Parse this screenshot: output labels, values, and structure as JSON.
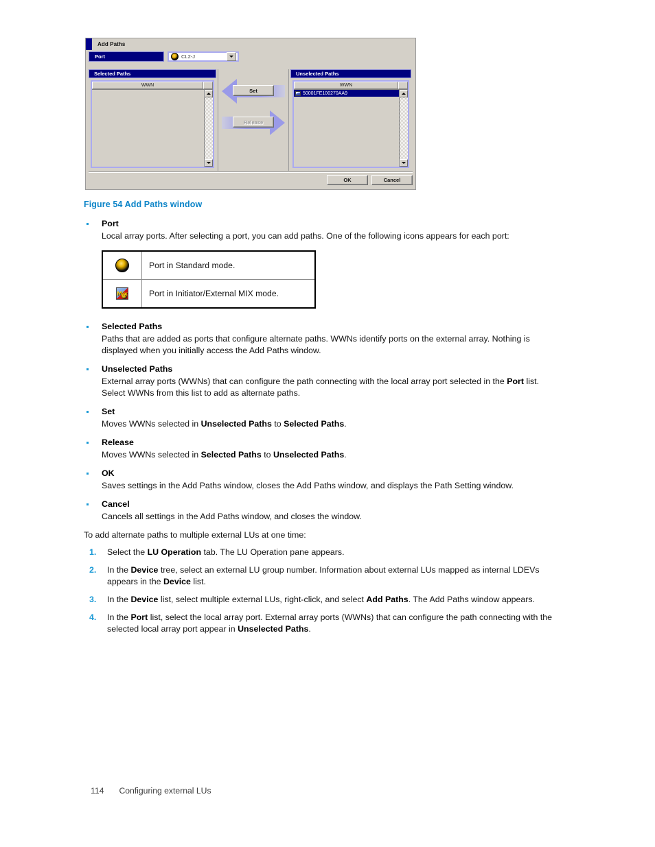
{
  "figure": {
    "dialog": {
      "title": "Add Paths",
      "port_label": "Port",
      "port_value": "CL2-J",
      "port_icon": "port-standard-icon",
      "selected_paths": {
        "header": "Selected Paths",
        "column": "WWN",
        "rows": []
      },
      "unselected_paths": {
        "header": "Unselected Paths",
        "column": "WWN",
        "rows": [
          "50001FE100270AA9"
        ]
      },
      "set_button": "Set",
      "release_button": "Release",
      "ok_button": "OK",
      "cancel_button": "Cancel"
    }
  },
  "caption": "Figure 54 Add Paths window",
  "bullets": [
    {
      "term": "Port",
      "body": "Local array ports. After selecting a port, you can add paths. One of the following icons appears for each port:"
    },
    {
      "term": "Selected Paths",
      "body": "Paths that are added as ports that configure alternate paths. WWNs identify ports on the external array. Nothing is displayed when you initially access the Add Paths window."
    },
    {
      "term": "Unselected Paths"
    },
    {
      "term": "Set"
    },
    {
      "term": "Release"
    },
    {
      "term": "OK",
      "body": "Saves settings in the Add Paths window, closes the Add Paths window, and displays the Path Setting window."
    },
    {
      "term": "Cancel",
      "body": "Cancels all settings in the Add Paths window, and closes the window."
    }
  ],
  "icon_table": {
    "rows": [
      {
        "icon": "port-standard-icon",
        "description": "Port in Standard mode."
      },
      {
        "icon": "port-initiator-external-mix-icon",
        "description": "Port in Initiator/External MIX mode."
      }
    ]
  },
  "intro": "To add alternate paths to multiple external LUs at one time:",
  "steps": [
    {
      "num": "1."
    },
    {
      "num": "2."
    },
    {
      "num": "3."
    },
    {
      "num": "4."
    }
  ],
  "footer": {
    "page_number": "114",
    "section": "Configuring external LUs"
  },
  "colors": {
    "accent": "#1b9ad6",
    "caption": "#0b84c8",
    "dialog_header": "#00007e",
    "selection": "#000080",
    "arrow": "#9a9ae8",
    "dialog_face": "#d4d0c8"
  }
}
